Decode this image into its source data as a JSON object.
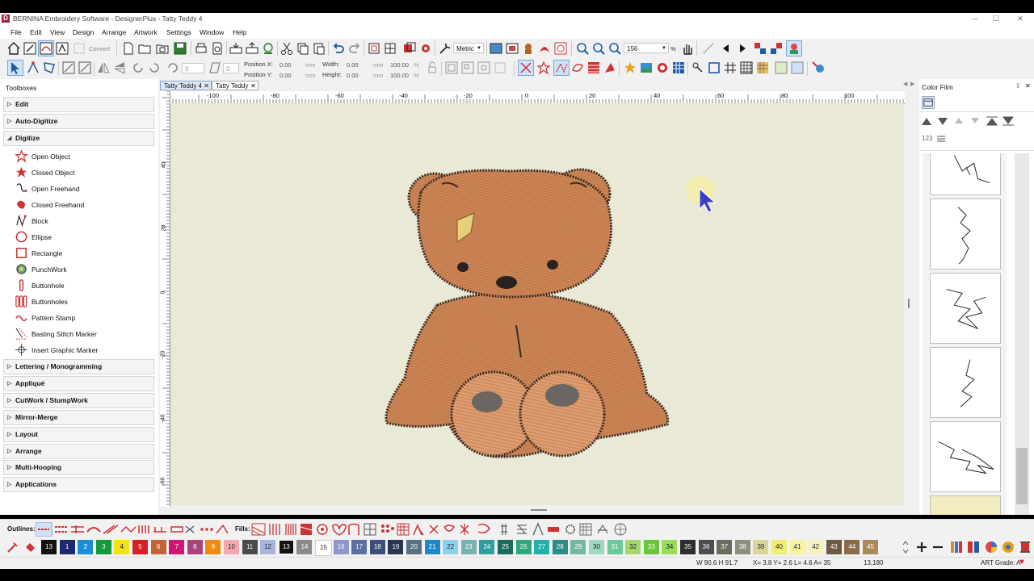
{
  "window": {
    "title": "BERNINA Embroidery Software - DesignerPlus - Tatty Teddy 4",
    "logo": "D"
  },
  "menu": [
    "File",
    "Edit",
    "View",
    "Design",
    "Arrange",
    "Artwork",
    "Settings",
    "Window",
    "Help"
  ],
  "toolbar": {
    "convert_label": "Convert",
    "units": "Metric",
    "zoom": "156",
    "zoom_unit": "%"
  },
  "properties": {
    "pos_x_label": "Position X:",
    "pos_x": "0.00",
    "pos_y_label": "Position Y:",
    "pos_y": "0.00",
    "width_label": "Width:",
    "width": "0.00",
    "height_label": "Height:",
    "height": "0.00",
    "unit": "mm",
    "pct_w": "100.00",
    "pct_h": "100.00",
    "pct": "%",
    "rotate_value": "0",
    "slant_value": "0"
  },
  "toolboxes": {
    "title": "Toolboxes",
    "sections_top": [
      "Edit",
      "Auto-Digitize",
      "Digitize"
    ],
    "digitize_tools": [
      {
        "label": "Open Object",
        "icon": "open-object-icon"
      },
      {
        "label": "Closed Object",
        "icon": "closed-object-icon"
      },
      {
        "label": "Open Freehand",
        "icon": "open-freehand-icon"
      },
      {
        "label": "Closed Freehand",
        "icon": "closed-freehand-icon"
      },
      {
        "label": "Block",
        "icon": "block-icon"
      },
      {
        "label": "Ellipse",
        "icon": "ellipse-icon"
      },
      {
        "label": "Rectangle",
        "icon": "rectangle-icon"
      },
      {
        "label": "PunchWork",
        "icon": "punchwork-icon"
      },
      {
        "label": "Buttonhole",
        "icon": "buttonhole-icon"
      },
      {
        "label": "Buttonholes",
        "icon": "buttonholes-icon"
      },
      {
        "label": "Pattern Stamp",
        "icon": "pattern-stamp-icon"
      },
      {
        "label": "Basting Stitch Marker",
        "icon": "basting-marker-icon"
      },
      {
        "label": "Insert Graphic Marker",
        "icon": "graphic-marker-icon"
      }
    ],
    "sections_bottom": [
      "Lettering / Monogramming",
      "Appliqué",
      "CutWork / StumpWork",
      "Mirror-Merge",
      "Layout",
      "Arrange",
      "Multi-Hooping",
      "Applications"
    ]
  },
  "tabs": [
    "Tatty Teddy 4",
    "Tatty Teddy"
  ],
  "ruler": {
    "h_ticks": [
      "-100",
      "-80",
      "-60",
      "-40",
      "-20",
      "0",
      "20",
      "40",
      "60",
      "80",
      "100"
    ],
    "v_ticks": [
      "40",
      "20",
      "0",
      "-20",
      "-40",
      "-60"
    ]
  },
  "color_film": {
    "title": "Color Film",
    "sequence_label": "123"
  },
  "outlines_label": "Outlines:",
  "fills_label": "Fills:",
  "palette": [
    {
      "n": "13",
      "c": "#111111"
    },
    {
      "n": "1",
      "c": "#1b2a6e"
    },
    {
      "n": "2",
      "c": "#1a8fd6"
    },
    {
      "n": "3",
      "c": "#149a3a"
    },
    {
      "n": "4",
      "c": "#f2e21a"
    },
    {
      "n": "5",
      "c": "#d42028"
    },
    {
      "n": "6",
      "c": "#c0643a"
    },
    {
      "n": "7",
      "c": "#d01672"
    },
    {
      "n": "8",
      "c": "#a8447a"
    },
    {
      "n": "9",
      "c": "#f08a10"
    },
    {
      "n": "10",
      "c": "#f5a8b0"
    },
    {
      "n": "11",
      "c": "#4a4a4a"
    },
    {
      "n": "12",
      "c": "#a7b4de"
    },
    {
      "n": "13",
      "c": "#111111"
    },
    {
      "n": "14",
      "c": "#8a8a8a"
    },
    {
      "n": "15",
      "c": "#ffffff"
    },
    {
      "n": "16",
      "c": "#8d97c8"
    },
    {
      "n": "17",
      "c": "#5d6fa0"
    },
    {
      "n": "18",
      "c": "#3c4e7a"
    },
    {
      "n": "19",
      "c": "#2a3550"
    },
    {
      "n": "20",
      "c": "#5a6f84"
    },
    {
      "n": "21",
      "c": "#1e88c8"
    },
    {
      "n": "22",
      "c": "#8fd0ee"
    },
    {
      "n": "23",
      "c": "#7ab2b2"
    },
    {
      "n": "24",
      "c": "#2f9ea0"
    },
    {
      "n": "25",
      "c": "#1f6a5e"
    },
    {
      "n": "26",
      "c": "#2ea87c"
    },
    {
      "n": "27",
      "c": "#22b0a8"
    },
    {
      "n": "28",
      "c": "#2c8c86"
    },
    {
      "n": "29",
      "c": "#76b8a0"
    },
    {
      "n": "30",
      "c": "#9ed8c0"
    },
    {
      "n": "31",
      "c": "#6cc89a"
    },
    {
      "n": "32",
      "c": "#a4d86e"
    },
    {
      "n": "33",
      "c": "#6cc43c"
    },
    {
      "n": "34",
      "c": "#9adc5a"
    },
    {
      "n": "35",
      "c": "#2d2d2d"
    },
    {
      "n": "36",
      "c": "#4d4d4d"
    },
    {
      "n": "37",
      "c": "#6b6b60"
    },
    {
      "n": "38",
      "c": "#8f8f80"
    },
    {
      "n": "39",
      "c": "#d6d69a"
    },
    {
      "n": "40",
      "c": "#f0ee70"
    },
    {
      "n": "41",
      "c": "#f7f2a4"
    },
    {
      "n": "42",
      "c": "#f6f2c0"
    },
    {
      "n": "43",
      "c": "#6e5a40"
    },
    {
      "n": "44",
      "c": "#8b6a4a"
    },
    {
      "n": "45",
      "c": "#a98a5a"
    }
  ],
  "status": {
    "wh": "W  90.6 H  91.7",
    "xy": "X=   3.8 Y=   2.6 L=   4.6 A=  35",
    "stitches": "13,180",
    "art_grade": "ART Grade: A"
  }
}
